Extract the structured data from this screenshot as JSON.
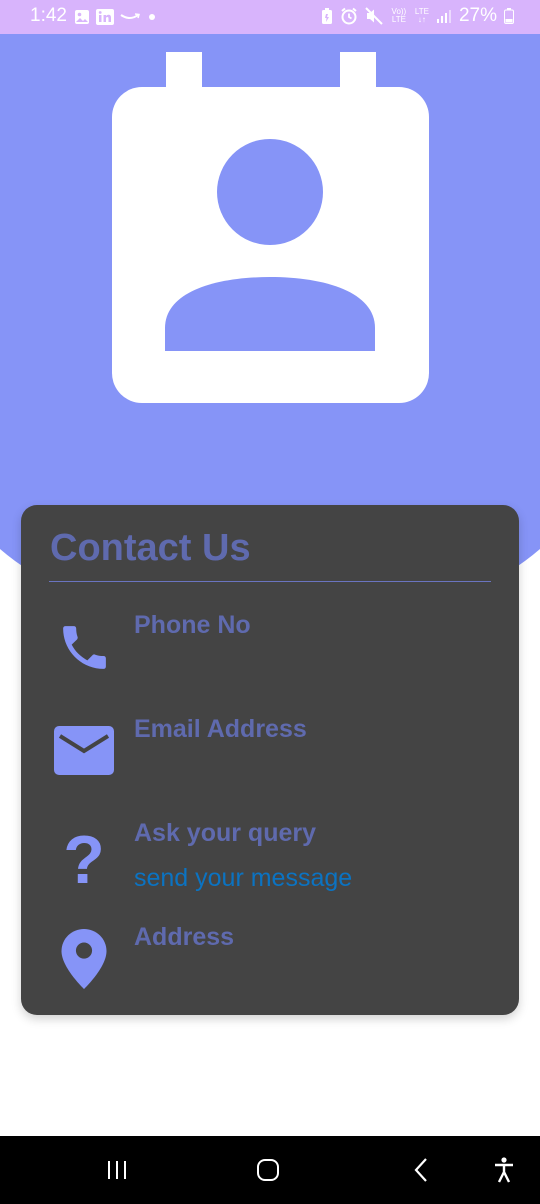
{
  "status_bar": {
    "time": "1:42",
    "battery": "27%",
    "left_icons": [
      "gallery-icon",
      "linkedin-icon",
      "amazon-icon",
      "dot-icon"
    ],
    "right_icons": [
      "battery-saver-icon",
      "alarm-icon",
      "mute-icon",
      "volte-icon",
      "lte-icon",
      "signal-icon",
      "battery-icon"
    ],
    "volte_label": "Vo)) LTE",
    "lte_label": "LTE"
  },
  "header": {
    "color": "#8694f7",
    "illustration": "contact-card-icon"
  },
  "card": {
    "title": "Contact Us",
    "items": [
      {
        "icon": "phone-icon",
        "label": "Phone No"
      },
      {
        "icon": "email-icon",
        "label": "Email Address"
      },
      {
        "icon": "question-icon",
        "label": "Ask your query",
        "link": "send your message"
      },
      {
        "icon": "location-icon",
        "label": "Address"
      }
    ]
  },
  "nav_bar": {
    "buttons": [
      "recent-apps-icon",
      "home-icon",
      "back-icon",
      "accessibility-icon"
    ]
  }
}
